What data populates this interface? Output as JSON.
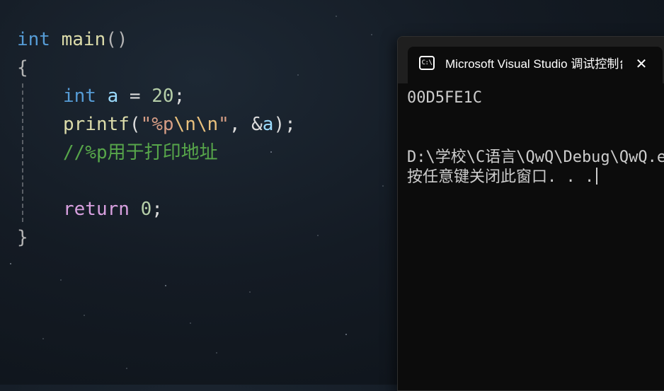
{
  "editor": {
    "line1": {
      "kw": "int",
      "fn": "main",
      "parens": "()"
    },
    "open_brace": "{",
    "line3": {
      "kw": "int",
      "var": "a",
      "op": " = ",
      "num": "20",
      "end": ";"
    },
    "line4": {
      "fn": "printf",
      "open": "(",
      "str_open": "\"%p",
      "esc": "\\n\\n",
      "str_close": "\"",
      "comma": ", ",
      "amp": "&",
      "var": "a",
      "close": ");"
    },
    "comment": "//%p用于打印地址",
    "line7": {
      "kw": "return",
      "num": "0",
      "end": ";"
    },
    "close_brace": "}"
  },
  "console": {
    "icon": "C:\\",
    "title": "Microsoft Visual Studio 调试控制台",
    "close_glyph": "✕",
    "output_address": "00D5FE1C",
    "output_path": "D:\\学校\\C语言\\QwQ\\Debug\\QwQ.exe",
    "prompt": "按任意键关闭此窗口. . ."
  },
  "icons": {
    "console_icon": "terminal-icon",
    "close_icon": "close-icon"
  },
  "colors": {
    "background": "#141b24",
    "keyword": "#569cd6",
    "function": "#dcdcaa",
    "variable": "#9cdcfe",
    "number": "#b5cea8",
    "string": "#d69d85",
    "control_keyword": "#d8a0df",
    "comment": "#57a64a",
    "console_bg": "#0c0c0c",
    "console_text": "#cccccc"
  }
}
